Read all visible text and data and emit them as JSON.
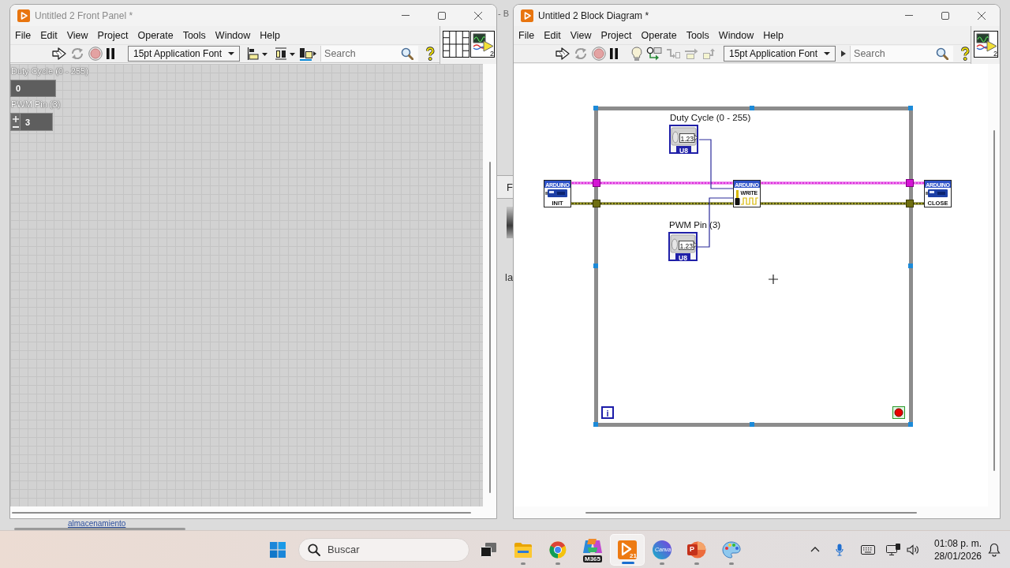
{
  "background_window": {
    "title_fragment": "- B",
    "tab_fragment": "F",
    "text_fragment": "la",
    "link": "almacenamiento"
  },
  "front_panel": {
    "title": "Untitled 2 Front Panel *",
    "active": false,
    "menu": [
      "File",
      "Edit",
      "View",
      "Project",
      "Operate",
      "Tools",
      "Window",
      "Help"
    ],
    "toolbar": {
      "font": "15pt Application Font",
      "search": {
        "placeholder": "Search"
      }
    },
    "icon_label": "2",
    "controls": [
      {
        "kind": "numeric",
        "label": "Duty Cycle (0 - 255)",
        "value": "0"
      },
      {
        "kind": "stepper",
        "label": "PWM Pin (3)",
        "value": "3"
      }
    ]
  },
  "block_diagram": {
    "title": "Untitled 2 Block Diagram *",
    "active": true,
    "menu": [
      "File",
      "Edit",
      "View",
      "Project",
      "Operate",
      "Tools",
      "Window",
      "Help"
    ],
    "toolbar": {
      "font": "15pt Application Font",
      "search": {
        "placeholder": "Search"
      }
    },
    "icon_label": "2",
    "loop": {
      "iteration": "i"
    },
    "nodes": [
      {
        "kind": "control",
        "label": "Duty Cycle (0 - 255)",
        "display": "1.23",
        "type": "U8"
      },
      {
        "kind": "subvi",
        "header": "ARDUINO",
        "caption": "INIT"
      },
      {
        "kind": "subvi_wave",
        "header": "ARDUINO",
        "caption": "WRITE"
      },
      {
        "kind": "subvi",
        "header": "ARDUINO",
        "caption": "CLOSE"
      },
      {
        "kind": "control",
        "label": "PWM Pin (3)",
        "display": "1.23",
        "type": "U8"
      }
    ]
  },
  "taskbar": {
    "search": {
      "placeholder": "Buscar"
    },
    "apps": [
      {
        "kind": "taskview",
        "running": false,
        "selected": false
      },
      {
        "kind": "folder",
        "running": true,
        "selected": false
      },
      {
        "kind": "browser",
        "running": true,
        "selected": false
      },
      {
        "kind": "assistant",
        "badge": "M365",
        "running": false,
        "selected": false
      },
      {
        "kind": "labview",
        "badge": "21",
        "running": true,
        "selected": true
      },
      {
        "kind": "design",
        "badge": "Canva",
        "running": true,
        "selected": false
      },
      {
        "kind": "slides",
        "badge": "P",
        "running": true,
        "selected": false
      },
      {
        "kind": "palette",
        "running": true,
        "selected": false
      }
    ],
    "clock": {
      "time": "01:08 p. m.",
      "date": "28/01/2026"
    }
  }
}
